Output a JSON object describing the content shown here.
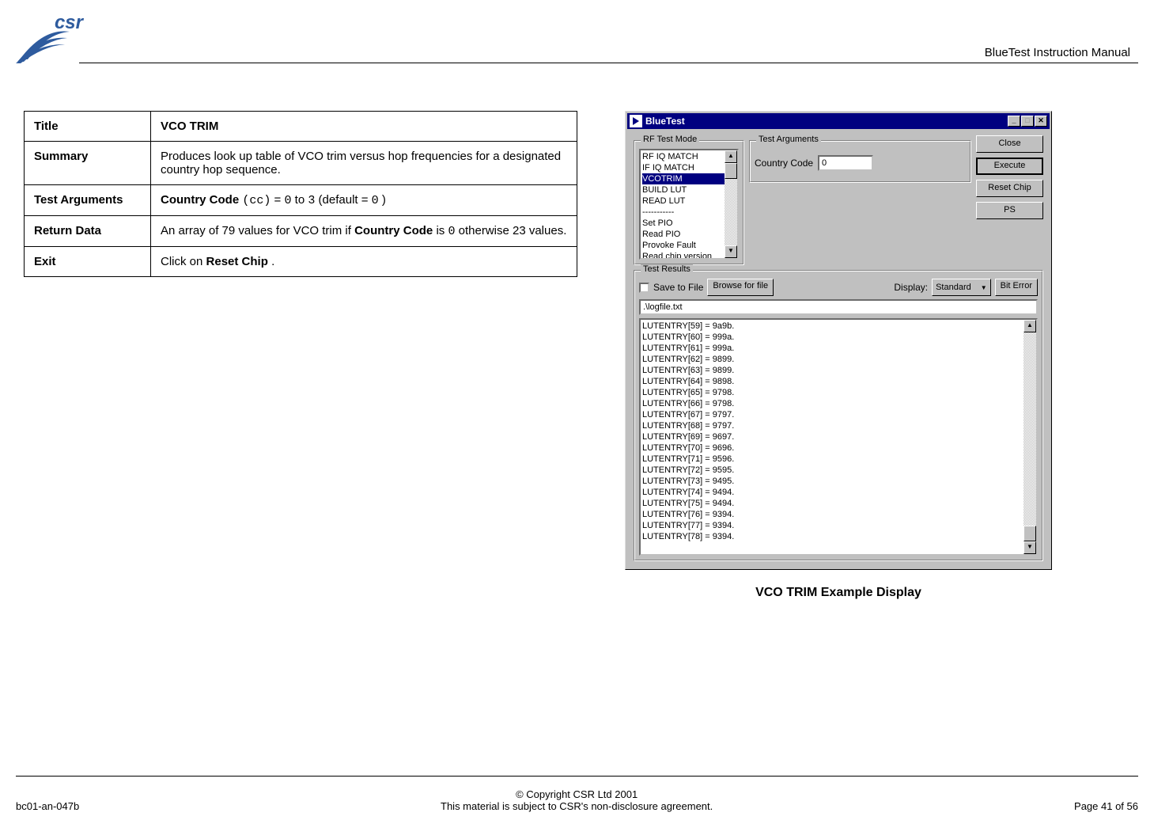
{
  "header": {
    "logo_text": "csr",
    "doc_title": "BlueTest Instruction Manual"
  },
  "table": {
    "rows": {
      "title": {
        "label": "Title",
        "value": "VCO TRIM"
      },
      "summary": {
        "label": "Summary",
        "value": "Produces look up table of VCO trim versus hop frequencies for a designated country hop sequence."
      },
      "test_args": {
        "label": "Test Arguments",
        "bold1": "Country Code",
        "mono1": "(cc)",
        "txt1": " = ",
        "mono2": "0",
        "txt2": " to ",
        "mono3": "3",
        "txt3": " (default = ",
        "mono4": "0",
        "txt4": ")"
      },
      "return_data": {
        "label": "Return Data",
        "txt1": "An array of 79 values for VCO trim if ",
        "bold1": "Country Code",
        "txt2": " is ",
        "mono1": "0",
        "txt3": " otherwise 23 values."
      },
      "exit": {
        "label": "Exit",
        "txt1": "Click on ",
        "bold1": "Reset Chip",
        "txt2": "."
      }
    }
  },
  "app": {
    "title": "BlueTest",
    "groups": {
      "rf_mode": "RF Test Mode",
      "test_args": "Test Arguments",
      "test_results": "Test Results"
    },
    "rf_list": [
      "RF IQ MATCH",
      "IF IQ MATCH",
      "VCOTRIM",
      "BUILD LUT",
      "READ LUT",
      "-----------",
      "Set PIO",
      "Read PIO",
      "Provoke Fault",
      "Read chip version"
    ],
    "rf_selected_index": 2,
    "arg_label": "Country Code",
    "arg_value": "0",
    "buttons": {
      "close": "Close",
      "execute": "Execute",
      "reset": "Reset Chip",
      "ps": "PS",
      "browse": "Browse for file",
      "standard": "Standard",
      "biterror": "Bit Error"
    },
    "save_label": "Save to File",
    "display_label": "Display:",
    "log_path": ".\\logfile.txt",
    "results": [
      "LUTENTRY[59] = 9a9b.",
      "LUTENTRY[60] = 999a.",
      "LUTENTRY[61] = 999a.",
      "LUTENTRY[62] = 9899.",
      "LUTENTRY[63] = 9899.",
      "LUTENTRY[64] = 9898.",
      "LUTENTRY[65] = 9798.",
      "LUTENTRY[66] = 9798.",
      "LUTENTRY[67] = 9797.",
      "LUTENTRY[68] = 9797.",
      "LUTENTRY[69] = 9697.",
      "LUTENTRY[70] = 9696.",
      "LUTENTRY[71] = 9596.",
      "LUTENTRY[72] = 9595.",
      "LUTENTRY[73] = 9495.",
      "LUTENTRY[74] = 9494.",
      "LUTENTRY[75] = 9494.",
      "LUTENTRY[76] = 9394.",
      "LUTENTRY[77] = 9394.",
      "LUTENTRY[78] = 9394."
    ]
  },
  "caption": "VCO TRIM Example Display",
  "footer": {
    "doc_id": "bc01-an-047b",
    "copyright": "© Copyright CSR Ltd 2001",
    "nda": "This material is subject to CSR's non-disclosure agreement.",
    "page": "Page 41 of 56"
  }
}
